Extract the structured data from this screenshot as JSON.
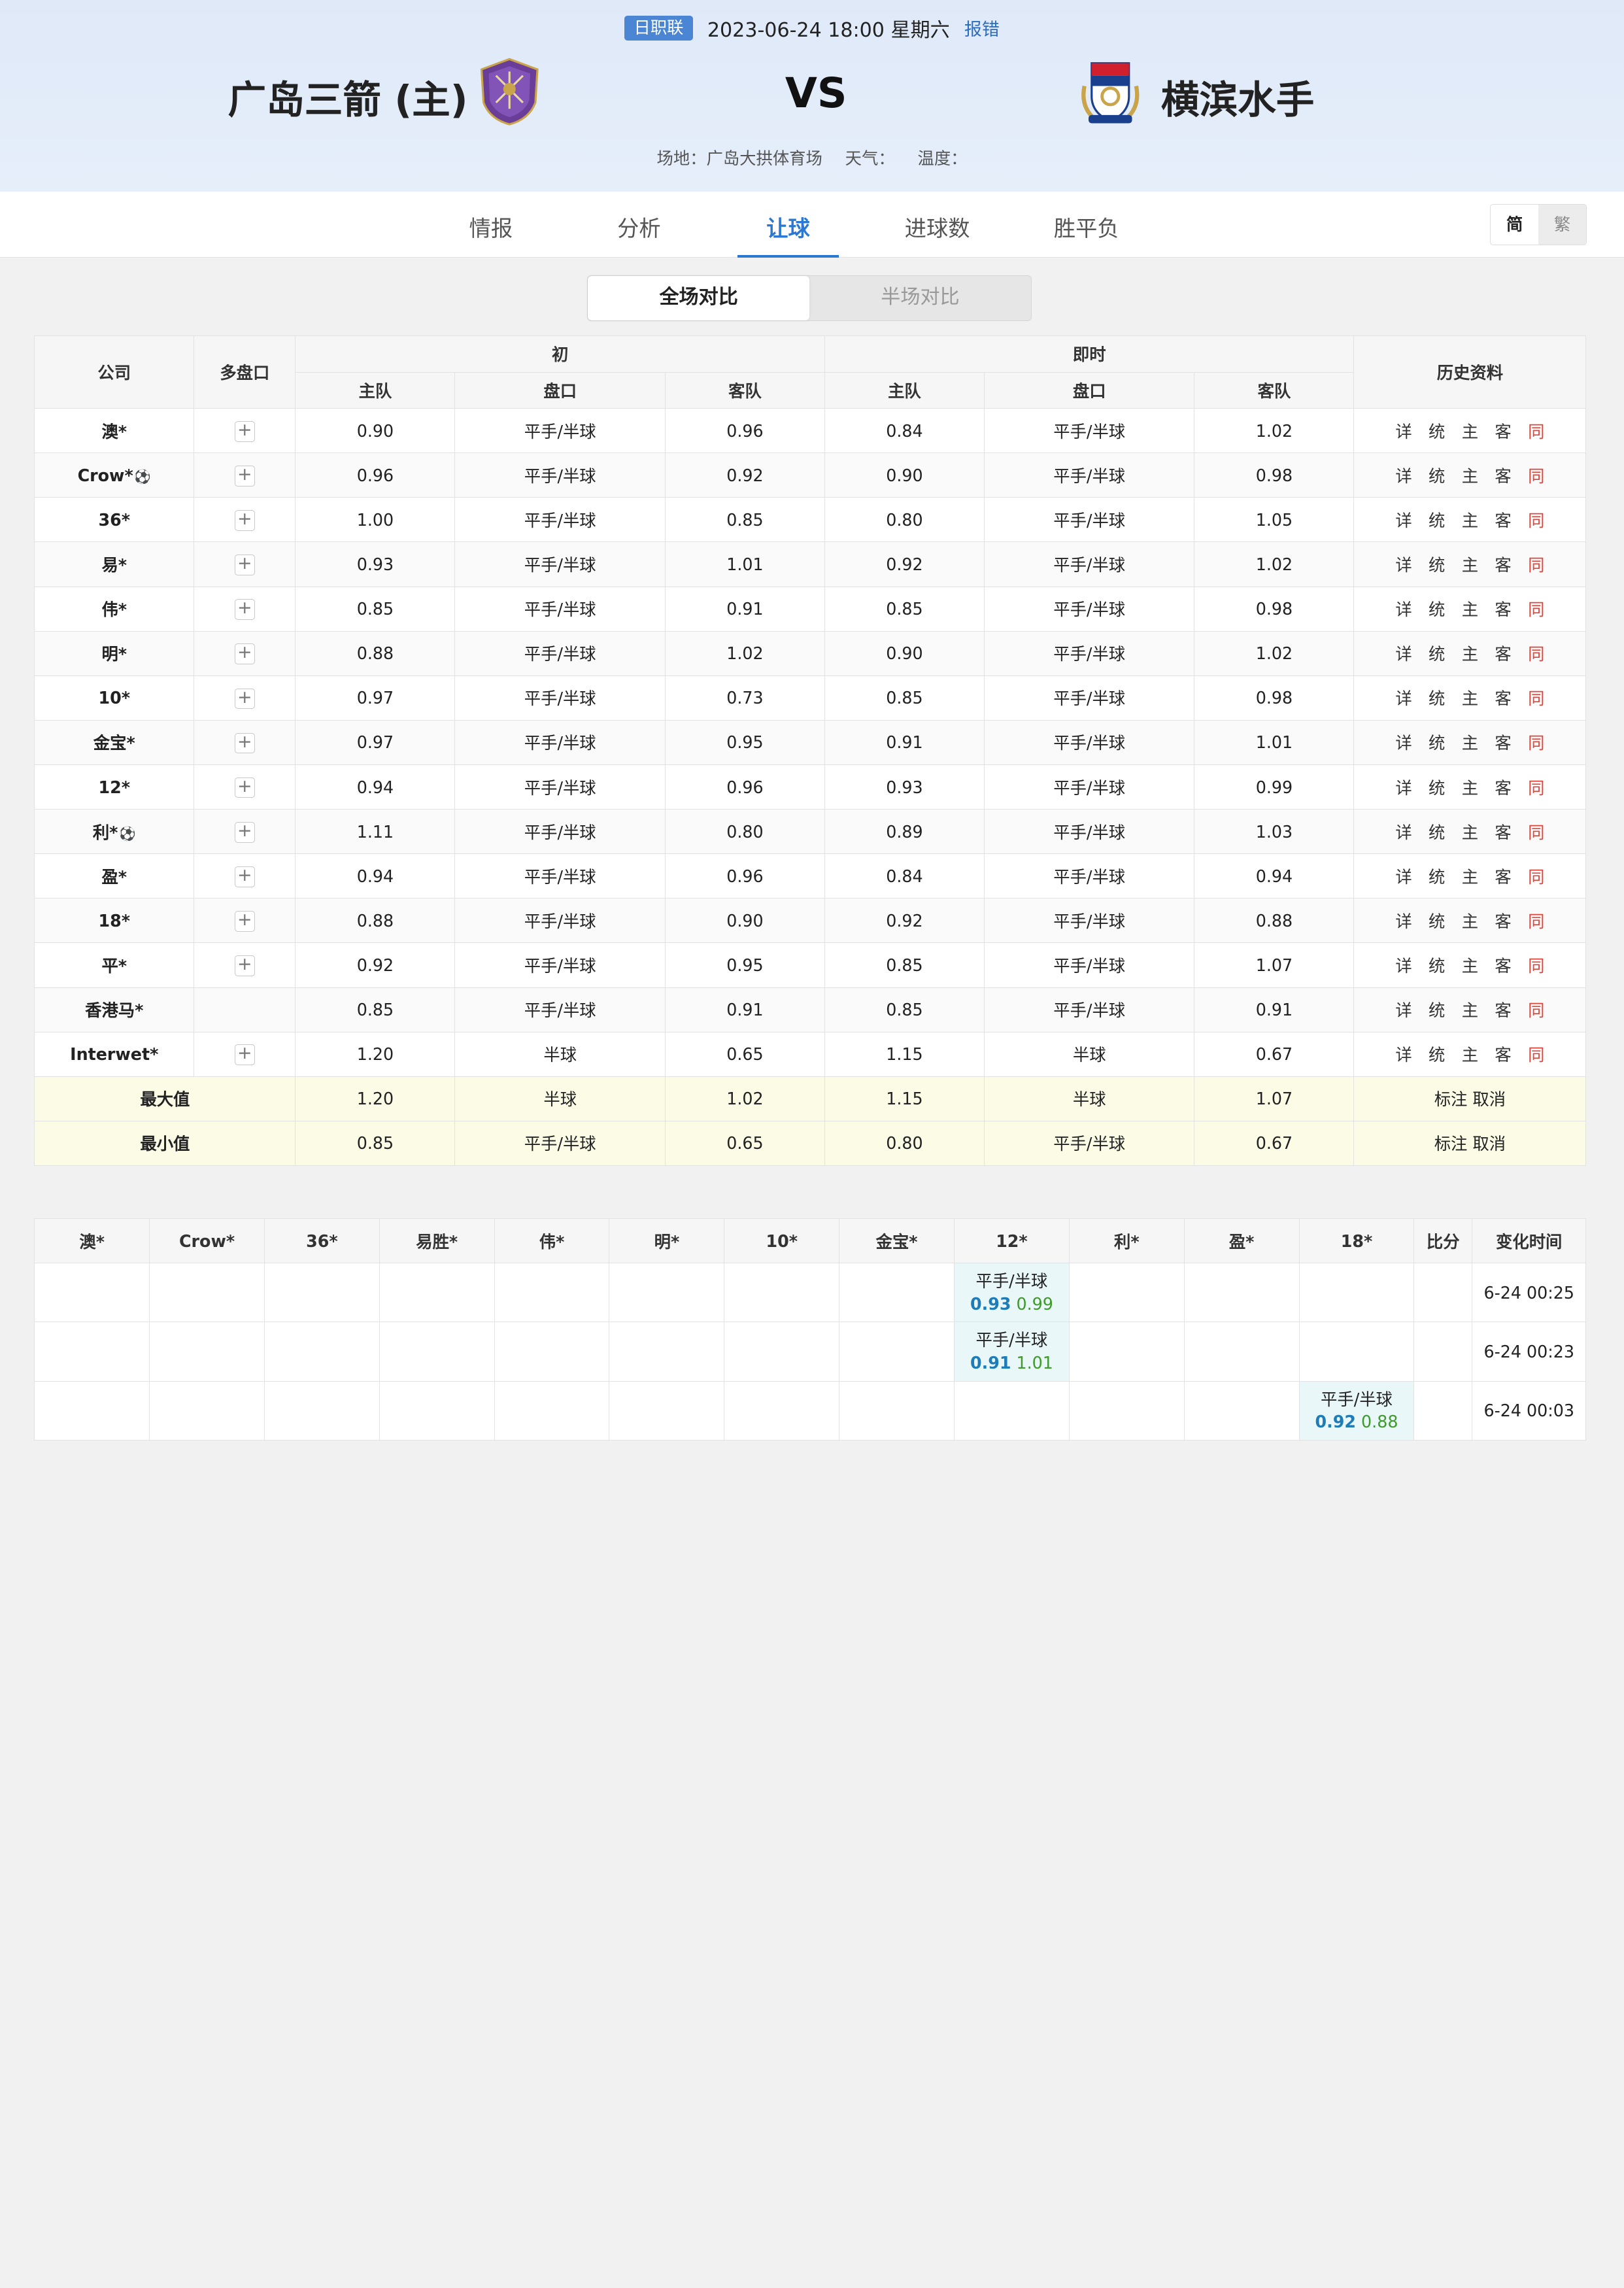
{
  "match": {
    "league": "日职联",
    "datetime": "2023-06-24 18:00 星期六",
    "report_label": "报错",
    "home_team": "广岛三箭 (主)",
    "away_team": "横滨水手",
    "vs": "VS",
    "venue": "场地：广岛大拱体育场",
    "weather": "天气：",
    "temperature": "温度："
  },
  "tabs": [
    "情报",
    "分析",
    "让球",
    "进球数",
    "胜平负"
  ],
  "active_tab": "让球",
  "lang": {
    "simplified": "简",
    "traditional": "繁"
  },
  "segment": {
    "full": "全场对比",
    "half": "半场对比"
  },
  "colors": {
    "accent": "#2b78d4",
    "same_link": "#e0443a",
    "summary_bg": "#fbfbe6",
    "change_bg": "#e9f7f9"
  },
  "odds_table": {
    "headers": {
      "company": "公司",
      "multi": "多盘口",
      "initial": "初",
      "live": "即时",
      "home": "主队",
      "line": "盘口",
      "away": "客队",
      "history": "历史资料"
    },
    "history_links": [
      "详",
      "统",
      "主",
      "客",
      "同"
    ],
    "rows": [
      {
        "company": "澳*",
        "ball": false,
        "plus": true,
        "ih": "0.90",
        "il": "平手/半球",
        "ia": "0.96",
        "lh": "0.84",
        "ll": "平手/半球",
        "la": "1.02"
      },
      {
        "company": "Crow*",
        "ball": true,
        "plus": true,
        "ih": "0.96",
        "il": "平手/半球",
        "ia": "0.92",
        "lh": "0.90",
        "ll": "平手/半球",
        "la": "0.98"
      },
      {
        "company": "36*",
        "ball": false,
        "plus": true,
        "ih": "1.00",
        "il": "平手/半球",
        "ia": "0.85",
        "lh": "0.80",
        "ll": "平手/半球",
        "la": "1.05"
      },
      {
        "company": "易*",
        "ball": false,
        "plus": true,
        "ih": "0.93",
        "il": "平手/半球",
        "ia": "1.01",
        "lh": "0.92",
        "ll": "平手/半球",
        "la": "1.02"
      },
      {
        "company": "伟*",
        "ball": false,
        "plus": true,
        "ih": "0.85",
        "il": "平手/半球",
        "ia": "0.91",
        "lh": "0.85",
        "ll": "平手/半球",
        "la": "0.98"
      },
      {
        "company": "明*",
        "ball": false,
        "plus": true,
        "ih": "0.88",
        "il": "平手/半球",
        "ia": "1.02",
        "lh": "0.90",
        "ll": "平手/半球",
        "la": "1.02"
      },
      {
        "company": "10*",
        "ball": false,
        "plus": true,
        "ih": "0.97",
        "il": "平手/半球",
        "ia": "0.73",
        "lh": "0.85",
        "ll": "平手/半球",
        "la": "0.98"
      },
      {
        "company": "金宝*",
        "ball": false,
        "plus": true,
        "ih": "0.97",
        "il": "平手/半球",
        "ia": "0.95",
        "lh": "0.91",
        "ll": "平手/半球",
        "la": "1.01"
      },
      {
        "company": "12*",
        "ball": false,
        "plus": true,
        "ih": "0.94",
        "il": "平手/半球",
        "ia": "0.96",
        "lh": "0.93",
        "ll": "平手/半球",
        "la": "0.99"
      },
      {
        "company": "利*",
        "ball": true,
        "plus": true,
        "ih": "1.11",
        "il": "平手/半球",
        "ia": "0.80",
        "lh": "0.89",
        "ll": "平手/半球",
        "la": "1.03"
      },
      {
        "company": "盈*",
        "ball": false,
        "plus": true,
        "ih": "0.94",
        "il": "平手/半球",
        "ia": "0.96",
        "lh": "0.84",
        "ll": "平手/半球",
        "la": "0.94"
      },
      {
        "company": "18*",
        "ball": false,
        "plus": true,
        "ih": "0.88",
        "il": "平手/半球",
        "ia": "0.90",
        "lh": "0.92",
        "ll": "平手/半球",
        "la": "0.88"
      },
      {
        "company": "平*",
        "ball": false,
        "plus": true,
        "ih": "0.92",
        "il": "平手/半球",
        "ia": "0.95",
        "lh": "0.85",
        "ll": "平手/半球",
        "la": "1.07"
      },
      {
        "company": "香港马*",
        "ball": false,
        "plus": false,
        "ih": "0.85",
        "il": "平手/半球",
        "ia": "0.91",
        "lh": "0.85",
        "ll": "平手/半球",
        "la": "0.91"
      },
      {
        "company": "Interwet*",
        "ball": false,
        "plus": true,
        "ih": "1.20",
        "il": "半球",
        "ia": "0.65",
        "lh": "1.15",
        "ll": "半球",
        "la": "0.67"
      }
    ],
    "summary": [
      {
        "label": "最大值",
        "ih": "1.20",
        "il": "半球",
        "ia": "1.02",
        "lh": "1.15",
        "ll": "半球",
        "la": "1.07",
        "actions": "标注 取消"
      },
      {
        "label": "最小值",
        "ih": "0.85",
        "il": "平手/半球",
        "ia": "0.65",
        "lh": "0.80",
        "ll": "平手/半球",
        "la": "0.67",
        "actions": "标注 取消"
      }
    ]
  },
  "change_table": {
    "headers": [
      "澳*",
      "Crow*",
      "36*",
      "易胜*",
      "伟*",
      "明*",
      "10*",
      "金宝*",
      "12*",
      "利*",
      "盈*",
      "18*",
      "比分",
      "变化时间"
    ],
    "rows": [
      {
        "col": 8,
        "line": "平手/半球",
        "home": "0.93",
        "away": "0.99",
        "time": "6-24 00:25"
      },
      {
        "col": 8,
        "line": "平手/半球",
        "home": "0.91",
        "away": "1.01",
        "time": "6-24 00:23"
      },
      {
        "col": 11,
        "line": "平手/半球",
        "home": "0.92",
        "away": "0.88",
        "time": "6-24 00:03"
      }
    ]
  }
}
